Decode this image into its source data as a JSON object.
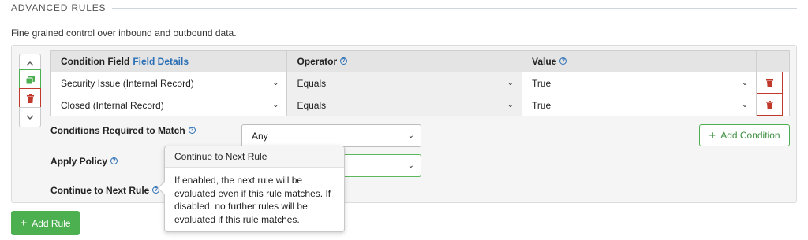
{
  "section": {
    "title": "ADVANCED RULES",
    "description": "Fine grained control over inbound and outbound data."
  },
  "table": {
    "headers": {
      "condition_field": "Condition Field",
      "field_details_link": "Field Details",
      "operator": "Operator",
      "value": "Value"
    },
    "rows": [
      {
        "field": "Security Issue (Internal Record)",
        "operator": "Equals",
        "value": "True"
      },
      {
        "field": "Closed (Internal Record)",
        "operator": "Equals",
        "value": "True"
      }
    ]
  },
  "form": {
    "conditions_label": "Conditions Required to Match",
    "conditions_value": "Any",
    "apply_policy_label": "Apply Policy",
    "continue_label": "Continue to Next Rule"
  },
  "buttons": {
    "add_condition": "Add Condition",
    "add_rule": "Add Rule"
  },
  "tooltip": {
    "title": "Continue to Next Rule",
    "body": "If enabled, the next rule will be evaluated even if this rule matches. If disabled, no further rules will be evaluated if this rule matches."
  },
  "icons": {
    "move_up": "chevron-up-icon",
    "copy": "copy-icon",
    "delete": "trash-icon",
    "move_down": "chevron-down-icon",
    "help": "question-circle-icon",
    "dropdown": "chevron-down-icon",
    "add": "plus-icon"
  },
  "colors": {
    "accent_green": "#4caf50",
    "danger_red": "#c0392b",
    "link_blue": "#2a6fb5"
  }
}
